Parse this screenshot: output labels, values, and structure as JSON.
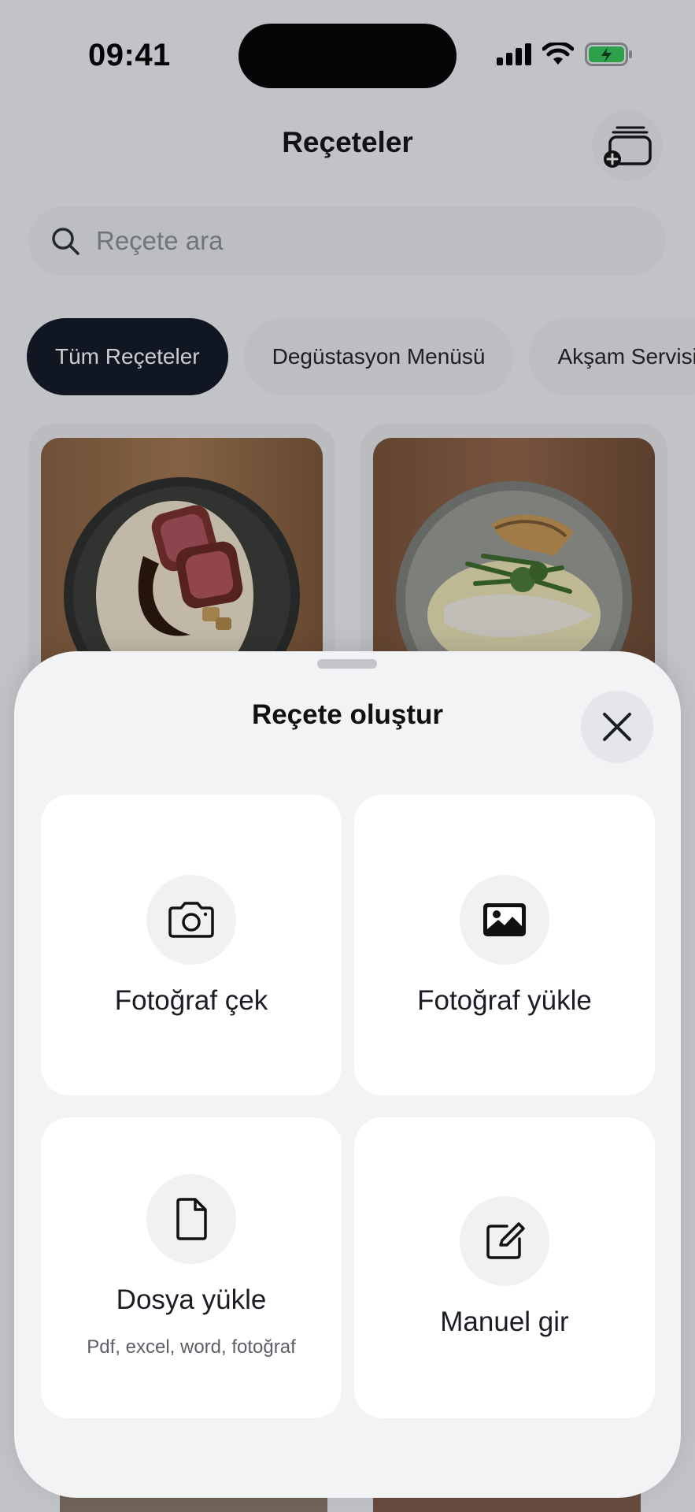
{
  "status_bar": {
    "time": "09:41"
  },
  "header": {
    "title": "Reçeteler",
    "add_icon": "add-to-collection-icon"
  },
  "search": {
    "placeholder": "Reçete ara",
    "icon": "search-icon"
  },
  "filters": [
    {
      "label": "Tüm Reçeteler",
      "active": true
    },
    {
      "label": "Degüstasyon Menüsü",
      "active": false
    },
    {
      "label": "Akşam Servisi",
      "active": false
    }
  ],
  "sheet": {
    "title": "Reçete oluştur",
    "close_icon": "close-icon",
    "options": [
      {
        "label": "Fotoğraf çek",
        "icon": "camera-icon",
        "subtitle": ""
      },
      {
        "label": "Fotoğraf yükle",
        "icon": "image-icon",
        "subtitle": ""
      },
      {
        "label": "Dosya yükle",
        "icon": "file-icon",
        "subtitle": "Pdf, excel, word, fotoğraf"
      },
      {
        "label": "Manuel gir",
        "icon": "edit-icon",
        "subtitle": ""
      }
    ]
  },
  "colors": {
    "active_chip": "#101624",
    "sheet_background": "#f2f3f5",
    "battery_green": "#34c759"
  }
}
